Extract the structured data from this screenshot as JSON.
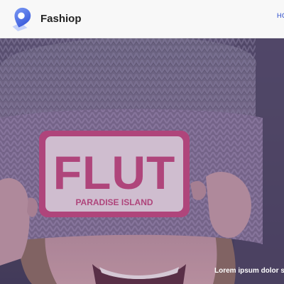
{
  "navbar": {
    "brand_name": "Fashiop",
    "brand_icon": "location-pin-icon",
    "nav_links": [
      "HOME"
    ],
    "link_color": "#1e40c8"
  },
  "hero": {
    "image": "woman-wearing-knit-beanie-photo",
    "patch_brand": "FLUT",
    "patch_subtitle": "PARADISE ISLAND",
    "caption": "Lorem ipsum dolor sit amet"
  },
  "colors": {
    "brand_blue": "#3f63e8",
    "patch_pink": "#c2477c",
    "overlay": "#5a3c78"
  }
}
